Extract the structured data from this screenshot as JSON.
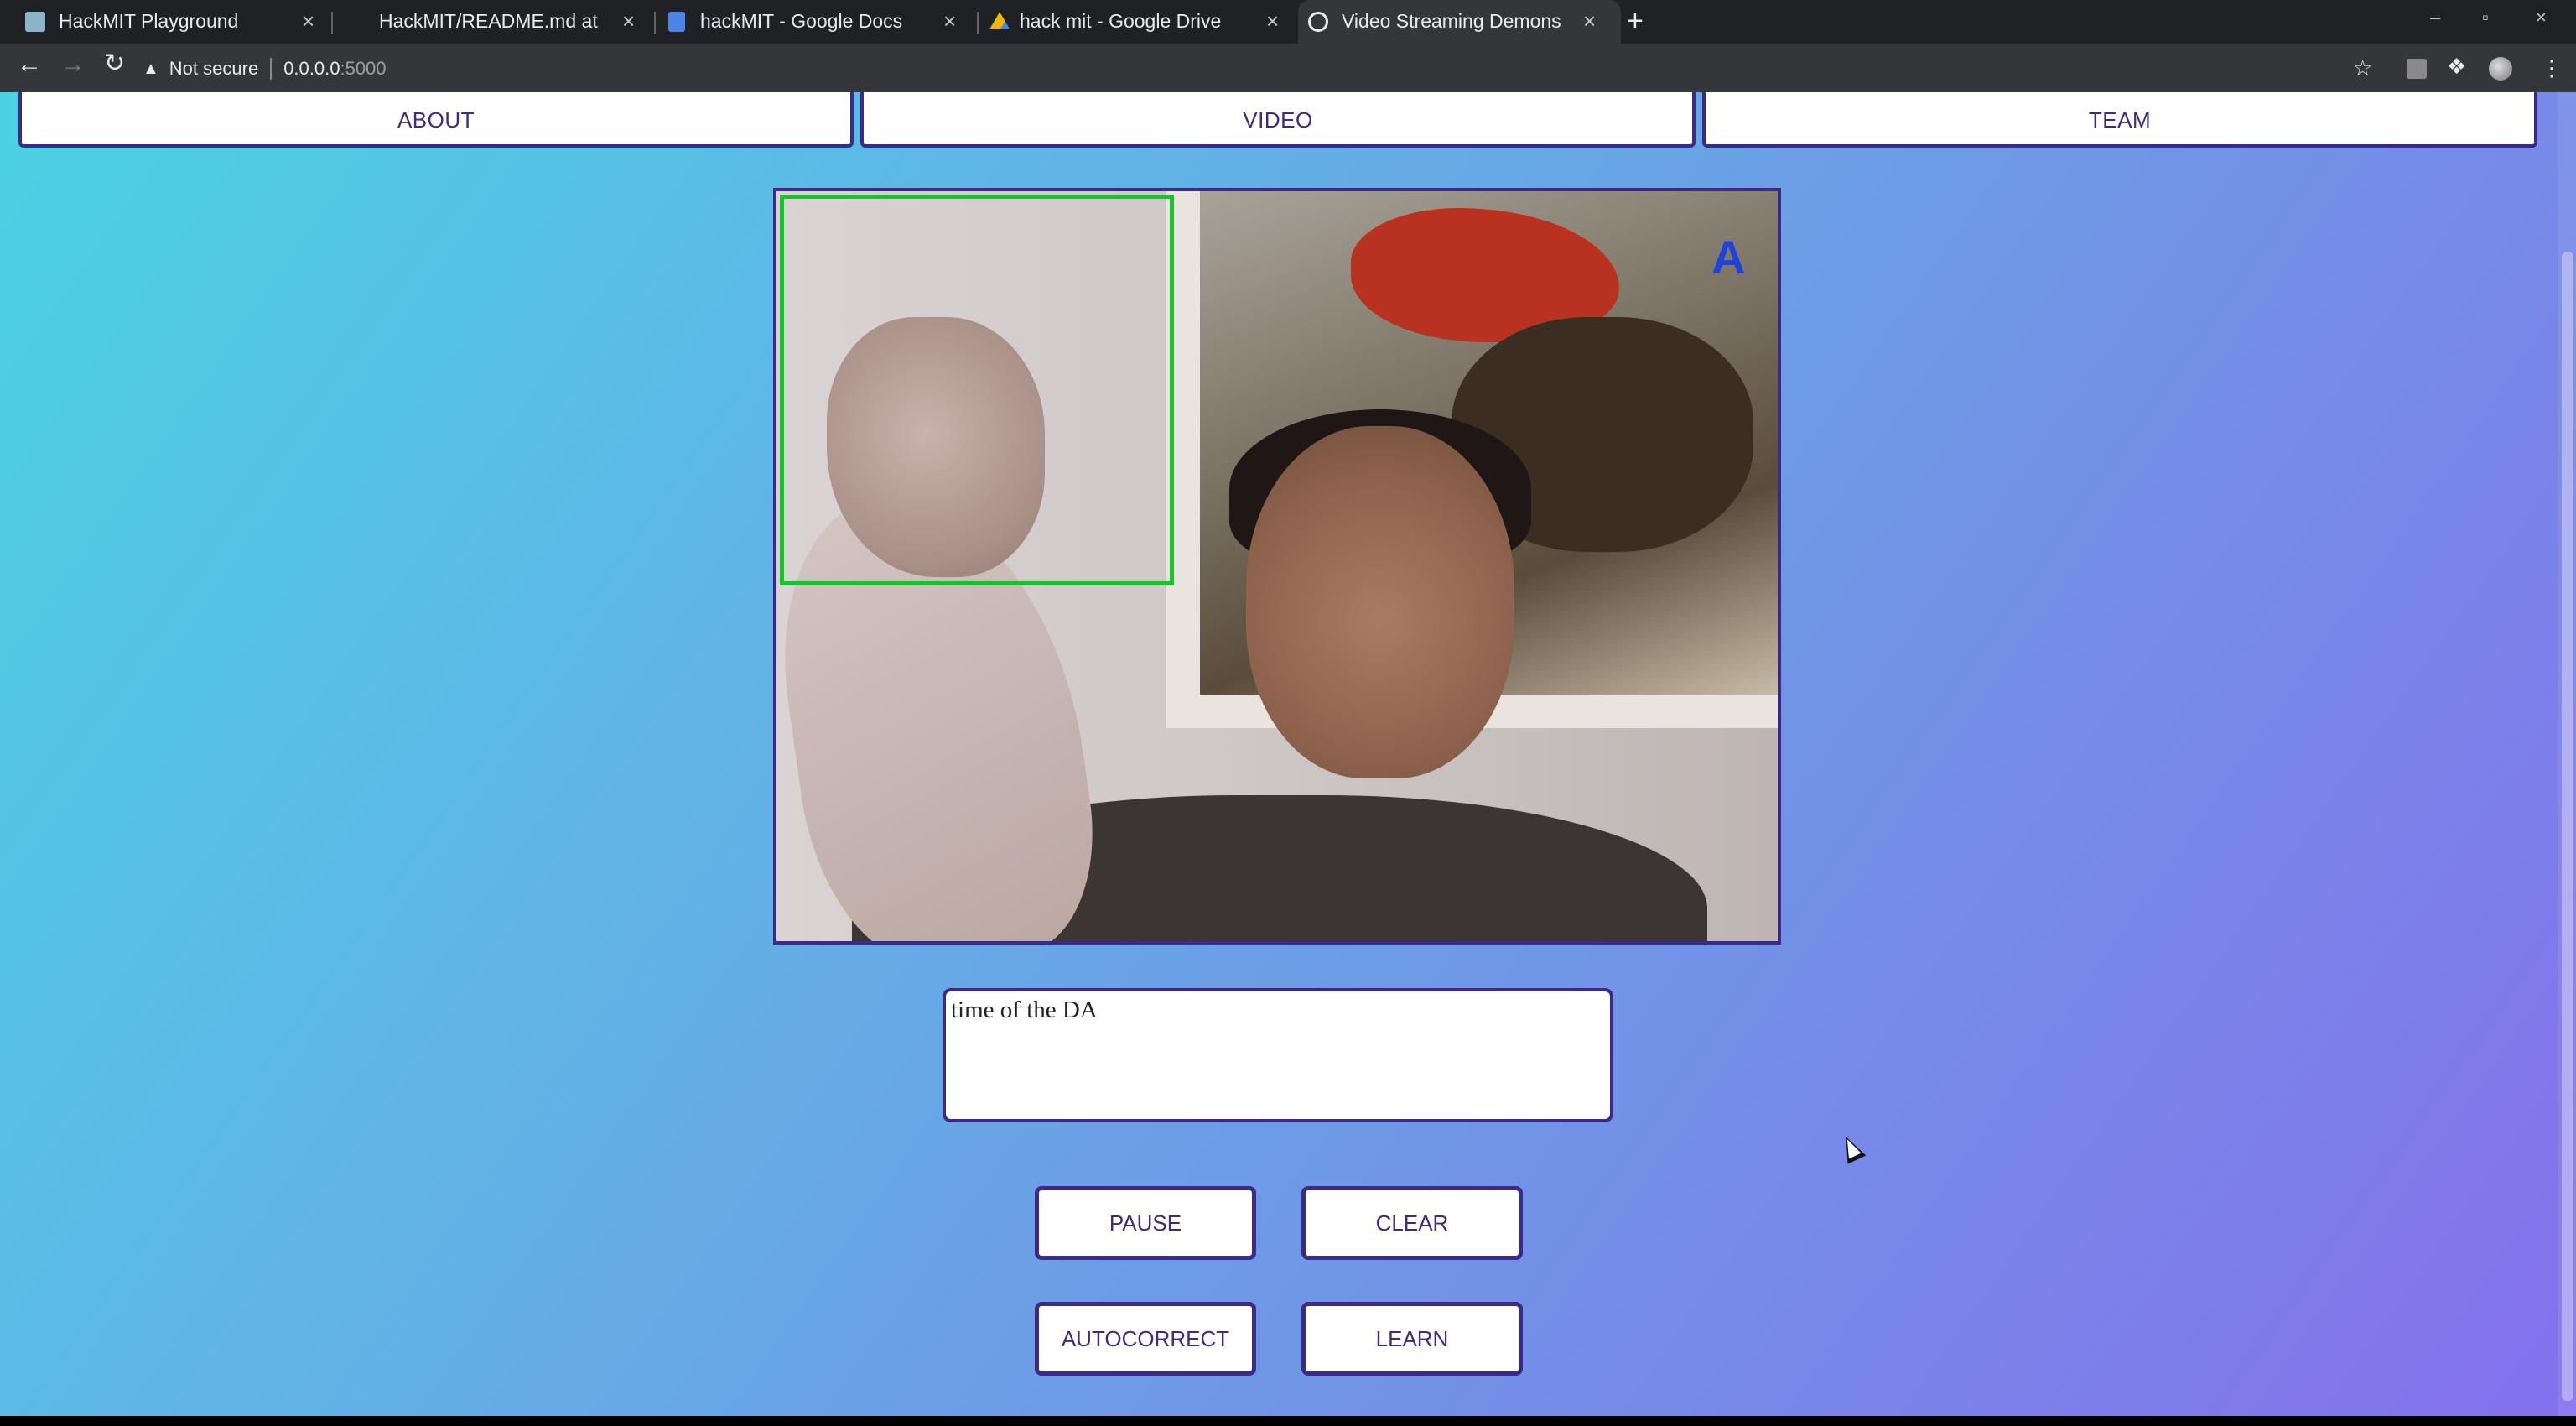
{
  "browser": {
    "tabs": [
      {
        "title": "HackMIT Playground",
        "close": "×"
      },
      {
        "title": "HackMIT/README.md at",
        "close": "×"
      },
      {
        "title": "hackMIT - Google Docs",
        "close": "×"
      },
      {
        "title": "hack mit - Google Drive",
        "close": "×"
      },
      {
        "title": "Video Streaming Demons",
        "close": "×"
      }
    ],
    "new_tab": "+",
    "address": {
      "security_label": "Not secure",
      "host": "0.0.0.0",
      "port": ":5000"
    },
    "window_controls": {
      "minimize": "–",
      "maximize": "▫",
      "close": "×"
    }
  },
  "nav": {
    "about": "ABOUT",
    "video": "VIDEO",
    "team": "TEAM"
  },
  "video": {
    "predicted_letter": "A"
  },
  "transcript": {
    "value": "time of the DA"
  },
  "controls": {
    "pause": "PAUSE",
    "clear": "CLEAR",
    "autocorrect": "AUTOCORRECT",
    "learn": "LEARN"
  },
  "colors": {
    "accent": "#3d2a86",
    "roi_box": "#17c42a",
    "prediction": "#1f42d8"
  }
}
